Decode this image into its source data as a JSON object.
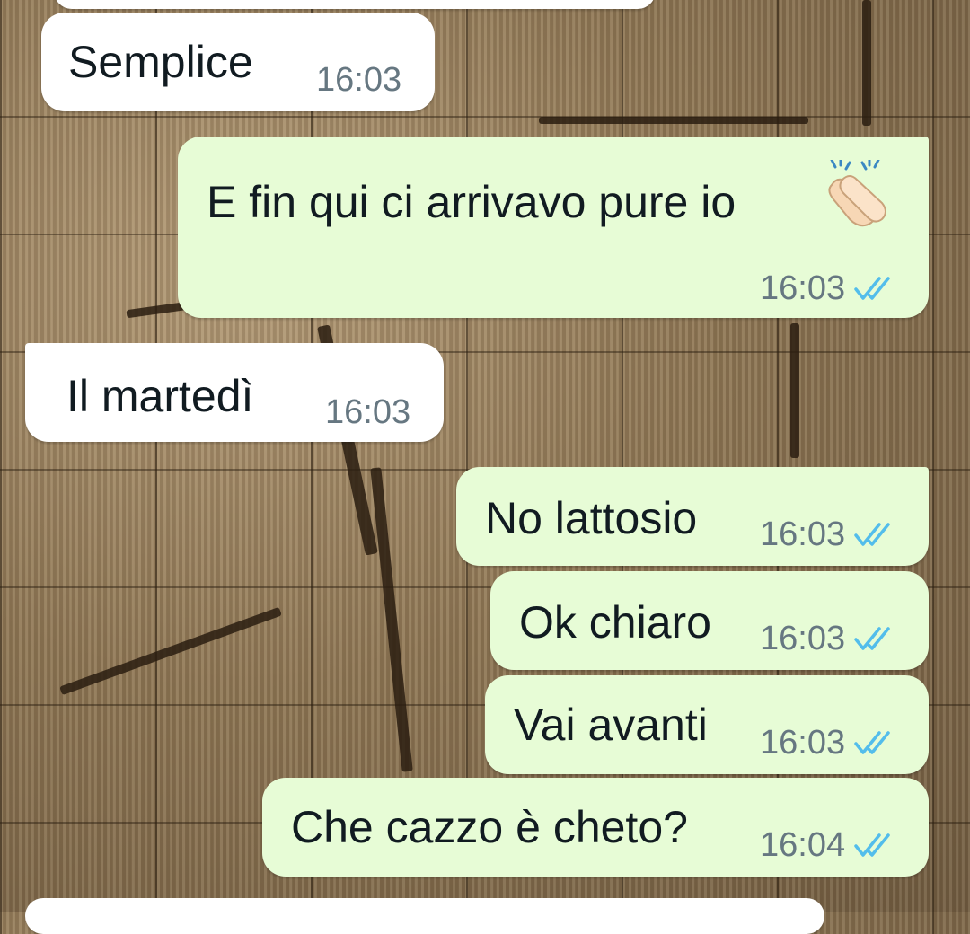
{
  "chat": {
    "messages": [
      {
        "id": "m1",
        "direction": "incoming",
        "text": "Semplice",
        "time": "16:03"
      },
      {
        "id": "m2",
        "direction": "outgoing",
        "text": "E fin qui ci arrivavo pure io",
        "emoji": "clapping-hands-icon",
        "time": "16:03",
        "status": "read"
      },
      {
        "id": "m3",
        "direction": "incoming",
        "text": "Il martedì",
        "time": "16:03"
      },
      {
        "id": "m4",
        "direction": "outgoing",
        "text": "No lattosio",
        "time": "16:03",
        "status": "read"
      },
      {
        "id": "m5",
        "direction": "outgoing",
        "text": "Ok chiaro",
        "time": "16:03",
        "status": "read"
      },
      {
        "id": "m6",
        "direction": "outgoing",
        "text": "Vai avanti",
        "time": "16:03",
        "status": "read"
      },
      {
        "id": "m7",
        "direction": "outgoing",
        "text": "Che cazzo è cheto?",
        "time": "16:04",
        "status": "read"
      }
    ]
  },
  "colors": {
    "incoming_bubble": "#ffffff",
    "outgoing_bubble": "#e7fcd6",
    "read_ticks": "#53bdeb",
    "timestamp": "#667781"
  }
}
